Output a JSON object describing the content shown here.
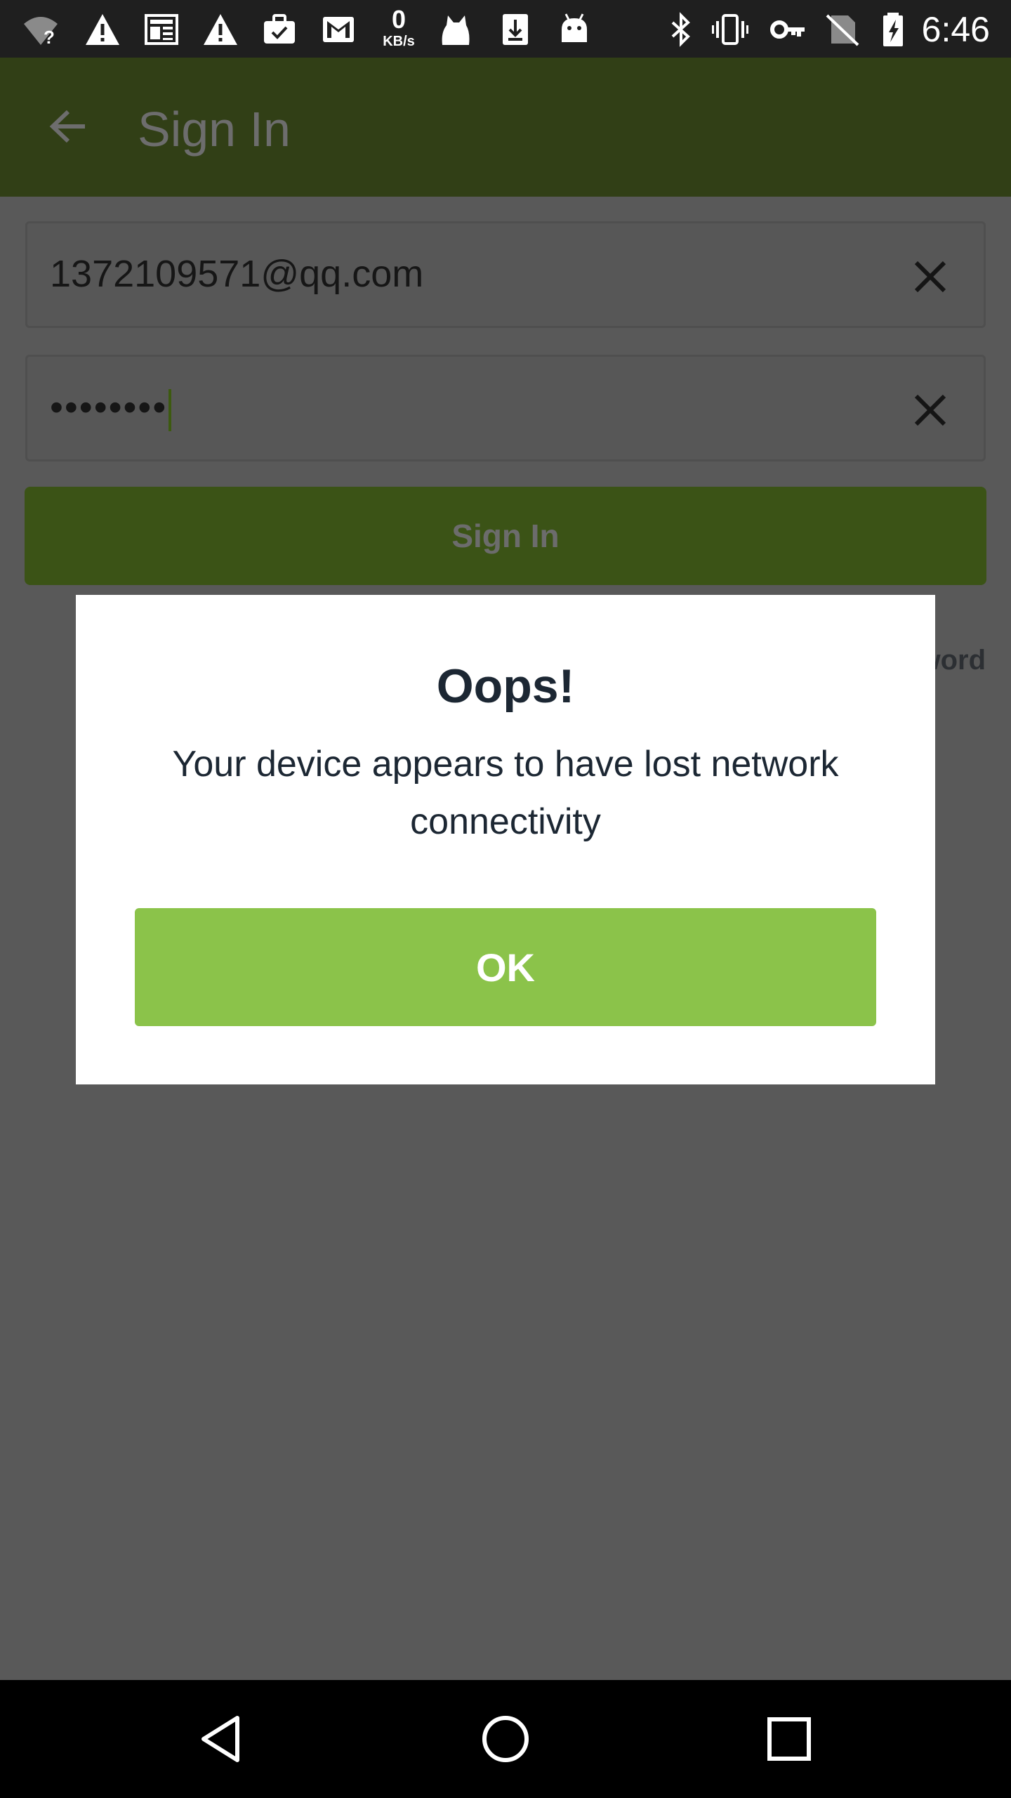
{
  "status_bar": {
    "speed_value": "0",
    "speed_unit": "KB/s",
    "time": "6:46",
    "icons": [
      "wifi-question-icon",
      "alert-icon",
      "news-icon",
      "alert-icon",
      "briefcase-check-icon",
      "gmail-icon",
      "cat-icon",
      "download-icon",
      "android-icon",
      "bluetooth-icon",
      "vibrate-icon",
      "vpn-key-icon",
      "no-sim-icon",
      "battery-charging-icon"
    ]
  },
  "app_bar": {
    "title": "Sign In",
    "back_icon": "arrow-left-icon"
  },
  "form": {
    "email_value": "1372109571@qq.com",
    "password_value": "••••••••",
    "sign_in_label": "Sign In",
    "forgot_partial": "word"
  },
  "dialog": {
    "title": "Oops!",
    "message": "Your device appears to have lost network connectivity",
    "ok_label": "OK"
  },
  "colors": {
    "accent": "#8bc34a",
    "app_bar": "#313f16",
    "scrim": "#595959"
  }
}
